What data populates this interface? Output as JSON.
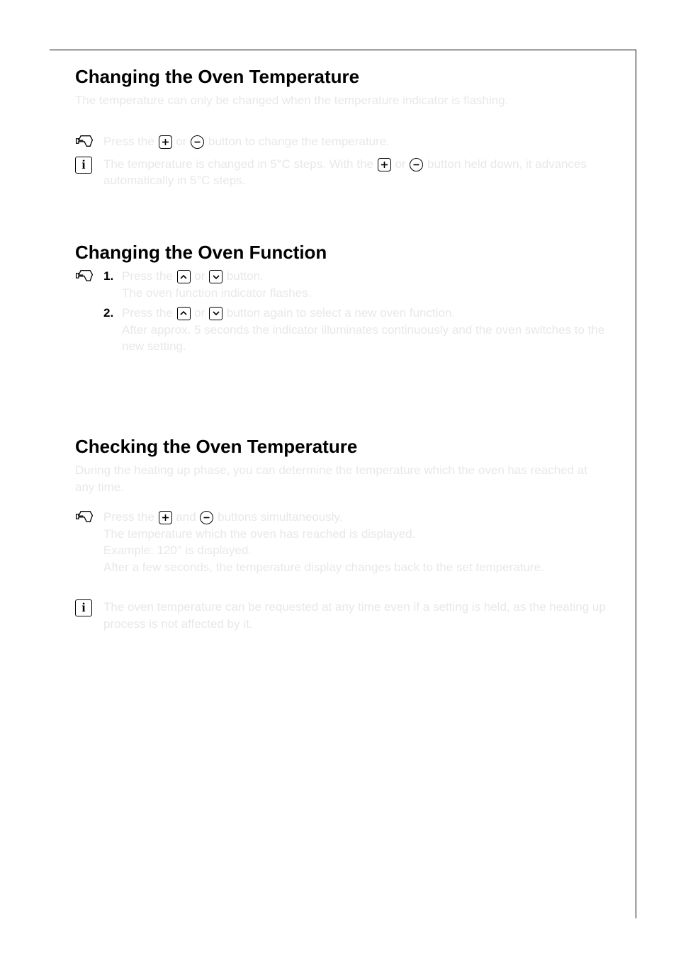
{
  "section1": {
    "heading": "Changing the Oven Temperature",
    "intro": "The temperature can only be changed when the temperature indicator is flashing.",
    "hand_line_pre": "Press the ",
    "hand_line_mid": " or ",
    "hand_line_post": " button to change the temperature.",
    "info_pre": "The temperature is changed in 5°C steps. With the ",
    "info_mid": " or ",
    "info_post": " button held down, it advances automatically in 5°C steps."
  },
  "section2": {
    "heading": "Changing the Oven Function",
    "step1_pre": "Press the ",
    "step1_mid": " or ",
    "step1_post": " button.",
    "step1_cont": "The oven function indicator flashes.",
    "step2_pre": "Press the ",
    "step2_mid": " or ",
    "step2_post": " button again to select a new oven function.",
    "step2_cont": "After approx. 5 seconds the indicator illuminates continuously and the oven switches to the new setting."
  },
  "section3": {
    "heading": "Checking the Oven Temperature",
    "intro": "During the heating up phase, you can determine the temperature which the oven has reached at any time.",
    "hand_pre": "Press the ",
    "hand_mid": " and ",
    "hand_post": " buttons simultaneously.",
    "cont1": "The temperature which the oven has reached is displayed.",
    "demo": "Example: 120° is displayed.",
    "cont2": "After a few seconds, the temperature display changes back to the set temperature.",
    "info": "The oven temperature can be requested at any time even if a setting is held, as the heating up process is not affected by it."
  }
}
